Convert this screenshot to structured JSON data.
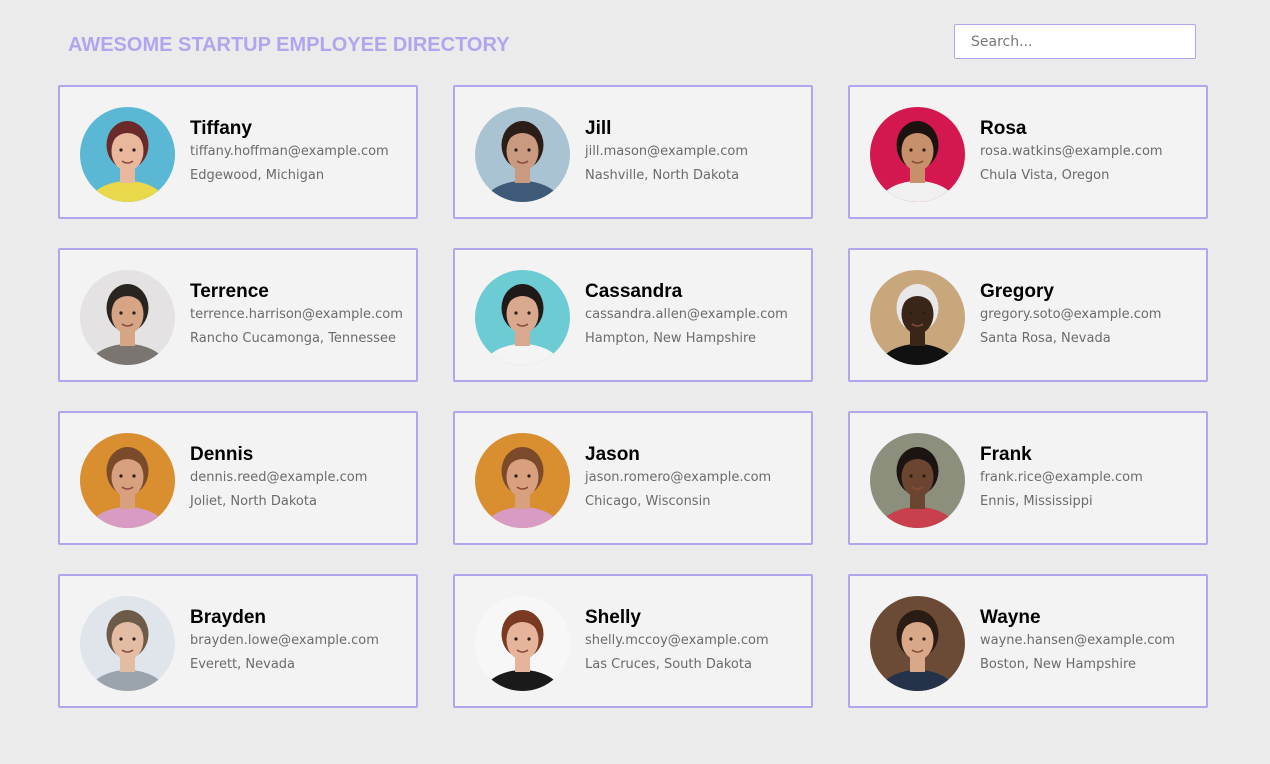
{
  "header": {
    "title": "AWESOME STARTUP EMPLOYEE DIRECTORY"
  },
  "search": {
    "placeholder": "Search...",
    "value": ""
  },
  "colors": {
    "accent": "#b1a6ee",
    "background": "#ebebeb",
    "card_background": "#f3f3f4"
  },
  "employees": [
    {
      "name": "Tiffany",
      "email": "tiffany.hoffman@example.com",
      "location": "Edgewood, Michigan",
      "bg": "#5bb8d4",
      "skin": "#e8b79c",
      "hair": "#6b2a2a",
      "shirt": "#e8d84a"
    },
    {
      "name": "Jill",
      "email": "jill.mason@example.com",
      "location": "Nashville, North Dakota",
      "bg": "#a9c3d3",
      "skin": "#c99a7f",
      "hair": "#2b1d17",
      "shirt": "#3d5b78"
    },
    {
      "name": "Rosa",
      "email": "rosa.watkins@example.com",
      "location": "Chula Vista, Oregon",
      "bg": "#d4184f",
      "skin": "#c8906a",
      "hair": "#1c1210",
      "shirt": "#f0f0f0"
    },
    {
      "name": "Terrence",
      "email": "terrence.harrison@example.com",
      "location": "Rancho Cucamonga, Tennessee",
      "bg": "#e4e2e2",
      "skin": "#d6a586",
      "hair": "#2a2420",
      "shirt": "#7a7570"
    },
    {
      "name": "Cassandra",
      "email": "cassandra.allen@example.com",
      "location": "Hampton, New Hampshire",
      "bg": "#6ccbd3",
      "skin": "#d9a98f",
      "hair": "#1f1a18",
      "shirt": "#f4f4f4"
    },
    {
      "name": "Gregory",
      "email": "gregory.soto@example.com",
      "location": "Santa Rosa, Nevada",
      "bg": "#c9a77d",
      "skin": "#3a2619",
      "hair": "#e8e8e8",
      "shirt": "#111111"
    },
    {
      "name": "Dennis",
      "email": "dennis.reed@example.com",
      "location": "Joliet, North Dakota",
      "bg": "#d98e2f",
      "skin": "#d8a07f",
      "hair": "#7a4a2a",
      "shirt": "#d79bc4"
    },
    {
      "name": "Jason",
      "email": "jason.romero@example.com",
      "location": "Chicago, Wisconsin",
      "bg": "#d98e2f",
      "skin": "#d8a07f",
      "hair": "#7a4a2a",
      "shirt": "#d79bc4"
    },
    {
      "name": "Frank",
      "email": "frank.rice@example.com",
      "location": "Ennis, Mississippi",
      "bg": "#8d8f7d",
      "skin": "#6b4530",
      "hair": "#1b1411",
      "shirt": "#c7404b"
    },
    {
      "name": "Brayden",
      "email": "brayden.lowe@example.com",
      "location": "Everett, Nevada",
      "bg": "#dfe5ea",
      "skin": "#e2bda4",
      "hair": "#6d5a48",
      "shirt": "#9ba3ad"
    },
    {
      "name": "Shelly",
      "email": "shelly.mccoy@example.com",
      "location": "Las Cruces, South Dakota",
      "bg": "#f7f7f7",
      "skin": "#e6b49b",
      "hair": "#7a3a22",
      "shirt": "#1a1a1a"
    },
    {
      "name": "Wayne",
      "email": "wayne.hansen@example.com",
      "location": "Boston, New Hampshire",
      "bg": "#6b4b36",
      "skin": "#d9a888",
      "hair": "#2a1c14",
      "shirt": "#24324a"
    }
  ]
}
